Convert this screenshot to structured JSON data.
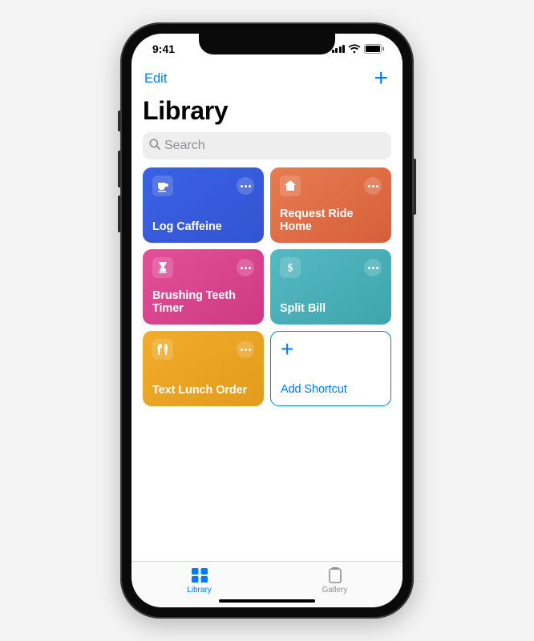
{
  "status": {
    "time": "9:41"
  },
  "nav": {
    "edit": "Edit"
  },
  "header": {
    "title": "Library"
  },
  "search": {
    "placeholder": "Search"
  },
  "tiles": [
    {
      "label": "Log Caffeine"
    },
    {
      "label": "Request Ride Home"
    },
    {
      "label": "Brushing Teeth Timer"
    },
    {
      "label": "Split Bill"
    },
    {
      "label": "Text Lunch Order"
    }
  ],
  "add": {
    "label": "Add Shortcut"
  },
  "tabs": {
    "library": "Library",
    "gallery": "Gallery"
  }
}
